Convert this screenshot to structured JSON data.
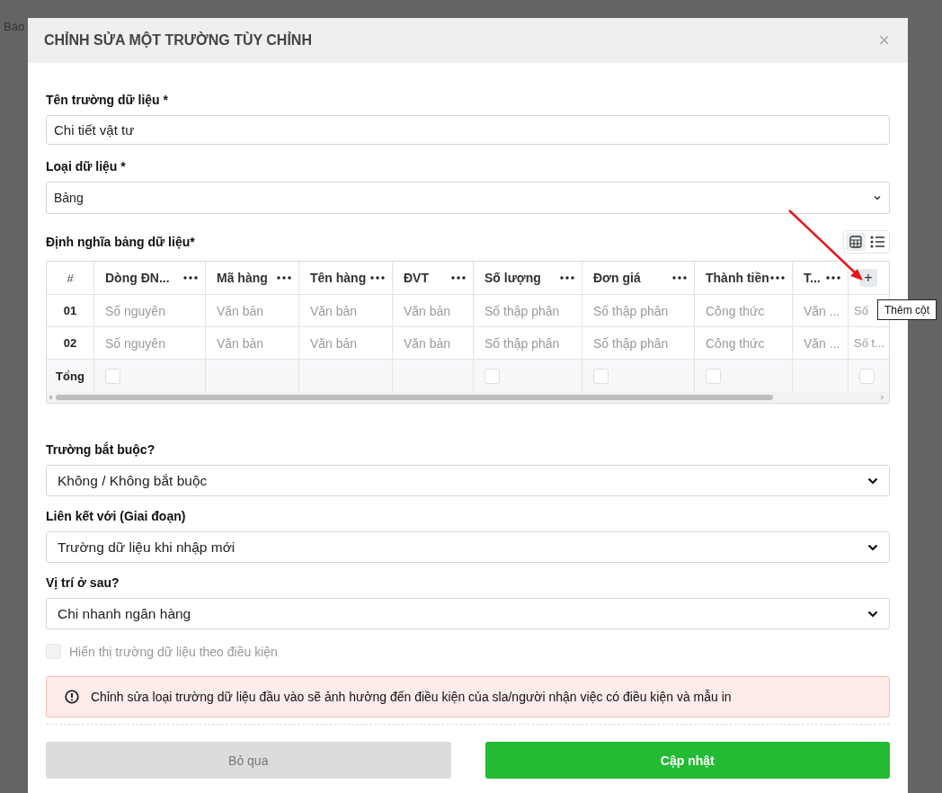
{
  "page": {
    "tab_fragment": "Báo"
  },
  "dialog": {
    "title": "CHỈNH SỬA MỘT TRƯỜNG TÙY CHỈNH",
    "close": "×",
    "fields": [
      {
        "kind": "text",
        "label": "Tên trường dữ liệu *",
        "value": "Chi tiết vật tư"
      },
      {
        "kind": "select",
        "label": "Loại dữ liệu *",
        "value": "Bảng"
      }
    ],
    "table_definition": {
      "label": "Định nghĩa bảng dữ liệu*",
      "view_toggle": [
        {
          "kind": "grid",
          "selected": true
        },
        {
          "kind": "list",
          "selected": false
        }
      ],
      "index_header": "#",
      "columns": [
        "Dòng ĐN...",
        "Mã hàng",
        "Tên hàng",
        "ĐVT",
        "Số lượng",
        "Đơn giá",
        "Thành tiền",
        "T..."
      ],
      "add_column_button": "+",
      "rows": [
        {
          "index": "01",
          "cells": [
            "Số nguyên",
            "Văn bản",
            "Văn bản",
            "Văn bản",
            "Số thập phân",
            "Số thập phân",
            "Công thức",
            "Văn ...",
            "Số"
          ]
        },
        {
          "index": "02",
          "cells": [
            "Số nguyên",
            "Văn bản",
            "Văn bản",
            "Văn bản",
            "Số thập phân",
            "Số thập phân",
            "Công thức",
            "Văn ...",
            "Số t..."
          ]
        }
      ],
      "footer": {
        "label": "Tổng",
        "cells": [
          {
            "kind": "checkbox",
            "checked": false
          },
          {
            "kind": "empty"
          },
          {
            "kind": "empty"
          },
          {
            "kind": "empty"
          },
          {
            "kind": "checkbox",
            "checked": false
          },
          {
            "kind": "checkbox",
            "checked": false
          },
          {
            "kind": "checkbox",
            "checked": false
          },
          {
            "kind": "empty"
          },
          {
            "kind": "checkbox",
            "checked": false
          }
        ]
      },
      "tooltip": "Thêm cột"
    },
    "selects": [
      {
        "label": "Trường bắt buộc?",
        "value": "Không / Không bắt buộc"
      },
      {
        "label": "Liên kết với (Giai đoạn)",
        "value": "Trường dữ liệu khi nhập mới"
      },
      {
        "label": "Vị trí ở sau?",
        "value": "Chi nhanh ngân hàng"
      }
    ],
    "conditional_checkbox": {
      "label": "Hiển thị trường dữ liệu theo điều kiện",
      "checked": false,
      "disabled": true
    },
    "alert": "Chỉnh sửa loại trường dữ liệu đầu vào sẽ ảnh hưởng đến điều kiện của sla/người nhận việc có điều kiện và mẫu in",
    "buttons": [
      {
        "kind": "cancel",
        "label": "Bỏ qua"
      },
      {
        "kind": "primary",
        "label": "Cập nhật"
      }
    ]
  }
}
